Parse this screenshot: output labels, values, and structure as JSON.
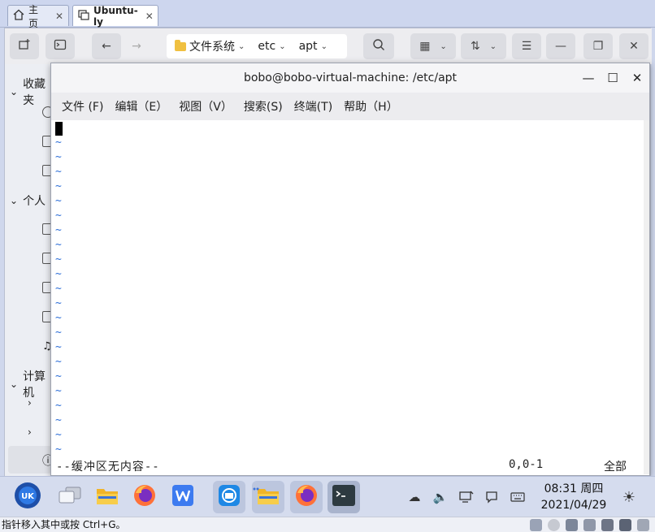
{
  "vm_tabs": [
    {
      "label": "主页",
      "icon": "home-icon"
    },
    {
      "label": "Ubuntu-ly",
      "icon": "vm-icon"
    }
  ],
  "file_manager": {
    "path": [
      "文件系统",
      "etc",
      "apt"
    ],
    "sidebar": [
      {
        "label": "收藏夹"
      },
      {
        "label": "个人"
      },
      {
        "label": "计算机"
      }
    ]
  },
  "terminal": {
    "title": "bobo@bobo-virtual-machine: /etc/apt",
    "menu": [
      "文件 (F)",
      "编辑（E）",
      "视图（V）",
      "搜索(S)",
      "终端(T)",
      "帮助（H）"
    ],
    "tilde_char": "~",
    "tilde_count": 22,
    "status_left": "--缓冲区无内容--",
    "status_pos": "0,0-1",
    "status_right": "全部"
  },
  "taskbar": {
    "time": "08:31 周四",
    "date": "2021/04/29"
  },
  "hint": {
    "text": "指针移入其中或按 Ctrl+G。"
  },
  "colors": {
    "tilde": "#2e6fd8",
    "taskbar_bg": "#d5dcee",
    "terminal_bg": "#ffffff"
  }
}
